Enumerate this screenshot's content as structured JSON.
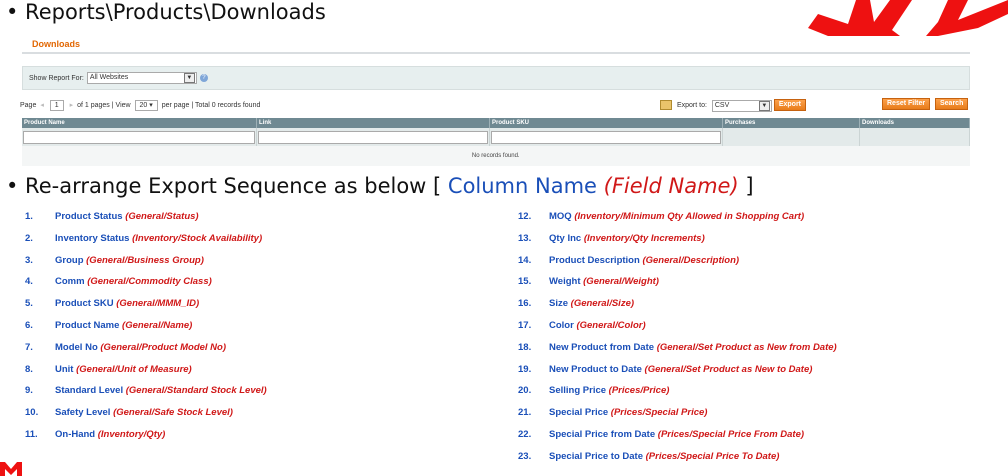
{
  "title1": "• Reports\\Products\\Downloads",
  "title2": {
    "prefix": "• Re-arrange Export Sequence as below [ ",
    "column": "Column Name",
    "field": "(Field Name)",
    "suffix": " ]"
  },
  "panel": {
    "tab": "Downloads",
    "show_report_label": "Show Report For:",
    "show_report_value": "All Websites",
    "pager": {
      "page_label": "Page",
      "page_value": "1",
      "of_pages": "of 1 pages",
      "view_label": "View",
      "view_value": "20",
      "per_page": "per page",
      "records": "Total 0 records found"
    },
    "export_label": "Export to:",
    "export_value": "CSV",
    "export_button": "Export",
    "reset_button": "Reset Filter",
    "search_button": "Search",
    "columns": [
      "Product Name",
      "Link",
      "Product SKU",
      "Purchases",
      "Downloads"
    ],
    "empty_text": "No records found."
  },
  "left_items": [
    {
      "num": "1.",
      "col": "Product Status",
      "field": "(General/Status)"
    },
    {
      "num": "2.",
      "col": "Inventory Status",
      "field": "(Inventory/Stock Availability)"
    },
    {
      "num": "3.",
      "col": "Group",
      "field": "(General/Business Group)"
    },
    {
      "num": "4.",
      "col": "Comm",
      "field": "(General/Commodity Class)"
    },
    {
      "num": "5.",
      "col": "Product SKU",
      "field": "(General/MMM_ID)"
    },
    {
      "num": "6.",
      "col": "Product Name",
      "field": "(General/Name)"
    },
    {
      "num": "7.",
      "col": "Model No",
      "field": "(General/Product Model No)"
    },
    {
      "num": "8.",
      "col": "Unit",
      "field": "(General/Unit of Measure)"
    },
    {
      "num": "9.",
      "col": "Standard Level",
      "field": "(General/Standard Stock Level)"
    },
    {
      "num": "10.",
      "col": "Safety Level",
      "field": "(General/Safe Stock Level)"
    },
    {
      "num": "11.",
      "col": "On-Hand",
      "field": "(Inventory/Qty)"
    }
  ],
  "right_items": [
    {
      "num": "12.",
      "col": "MOQ",
      "field": "(Inventory/Minimum Qty Allowed in Shopping Cart)"
    },
    {
      "num": "13.",
      "col": "Qty Inc",
      "field": "(Inventory/Qty Increments)"
    },
    {
      "num": "14.",
      "col": "Product Description",
      "field": "(General/Description)"
    },
    {
      "num": "15.",
      "col": "Weight",
      "field": "(General/Weight)"
    },
    {
      "num": "16.",
      "col": "Size",
      "field": "(General/Size)"
    },
    {
      "num": "17.",
      "col": "Color",
      "field": "(General/Color)"
    },
    {
      "num": "18.",
      "col": "New Product from Date",
      "field": "(General/Set Product as New from Date)"
    },
    {
      "num": "19.",
      "col": "New Product to Date",
      "field": "(General/Set Product as New to Date)"
    },
    {
      "num": "20.",
      "col": "Selling Price",
      "field": "(Prices/Price)"
    },
    {
      "num": "21.",
      "col": "Special Price",
      "field": "(Prices/Special Price)"
    },
    {
      "num": "22.",
      "col": "Special Price from Date",
      "field": "(Prices/Special Price From Date)"
    },
    {
      "num": "23.",
      "col": "Special Price to Date",
      "field": "(Prices/Special Price To Date)"
    }
  ],
  "colors": {
    "blue": "#1a4fb8",
    "red": "#d01818",
    "accent": "#e26703",
    "grid_header": "#6f8992"
  },
  "icons": [
    "starburst-decoration-icon",
    "help-icon",
    "export-icon",
    "dropdown-arrow-icon",
    "brand-mark-icon"
  ]
}
